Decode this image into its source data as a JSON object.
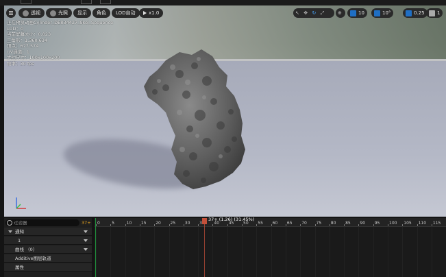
{
  "viewport_toolbar": {
    "menu_icon": "hamburger-icon",
    "perspective_label": "透视",
    "lighting_label": "光照",
    "show_label": "显示",
    "character_label": "角色",
    "lod_label": "LOD自动",
    "play_rate_label": "x1.0",
    "grid_value": "10",
    "angle_value": "10°",
    "scale_value": "0.25",
    "camera_speed_value": "1"
  },
  "stats": {
    "line1": "正在预览动画Cylinder_DE834427_Skel_Sequence",
    "line2": "LOD：0",
    "line3": "当前屏幕大小：0.823",
    "line4": "三角形：1,360,634",
    "line5": "顶点：677,574",
    "line6": "UV通道：1",
    "line7": "大约尺寸：100x100x200",
    "line8": "帧率：30 fps"
  },
  "track_panel": {
    "search_placeholder": "过滤器",
    "frame_count": "37+",
    "rows": [
      {
        "label": "通知"
      },
      {
        "label": "1"
      },
      {
        "label": "曲线 （0）"
      },
      {
        "label": "Additive图层轨道"
      },
      {
        "label": "属性"
      }
    ]
  },
  "timeline": {
    "playhead_label": "37+ (1.26) (31.45%)",
    "ticks": [
      "0",
      "5",
      "10",
      "15",
      "20",
      "25",
      "30",
      "35",
      "40",
      "45",
      "50",
      "55",
      "60",
      "65",
      "70",
      "75",
      "80",
      "85",
      "90",
      "95",
      "100",
      "105",
      "110",
      "115"
    ]
  },
  "colors": {
    "accent_blue": "#1f6fc4",
    "playhead": "#c4503a",
    "frame_orange": "#e0a020"
  }
}
